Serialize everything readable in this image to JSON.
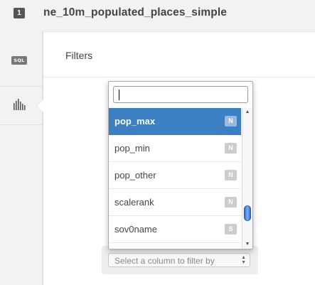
{
  "header": {
    "layer_number": "1",
    "layer_name": "ne_10m_populated_places_simple"
  },
  "sidebar": {
    "sql_label": "SQL"
  },
  "panel": {
    "title": "Filters"
  },
  "dropdown": {
    "search_value": "",
    "selected_index": 0,
    "options": [
      {
        "label": "pop_max",
        "type": "N"
      },
      {
        "label": "pop_min",
        "type": "N"
      },
      {
        "label": "pop_other",
        "type": "N"
      },
      {
        "label": "scalerank",
        "type": "N"
      },
      {
        "label": "sov0name",
        "type": "S"
      }
    ],
    "scroll_position": 0.82
  },
  "column_select": {
    "placeholder": "Select a column to filter by"
  },
  "colors": {
    "selected_row": "#3b7fc4",
    "scroll_thumb": "#2d6bd4"
  }
}
